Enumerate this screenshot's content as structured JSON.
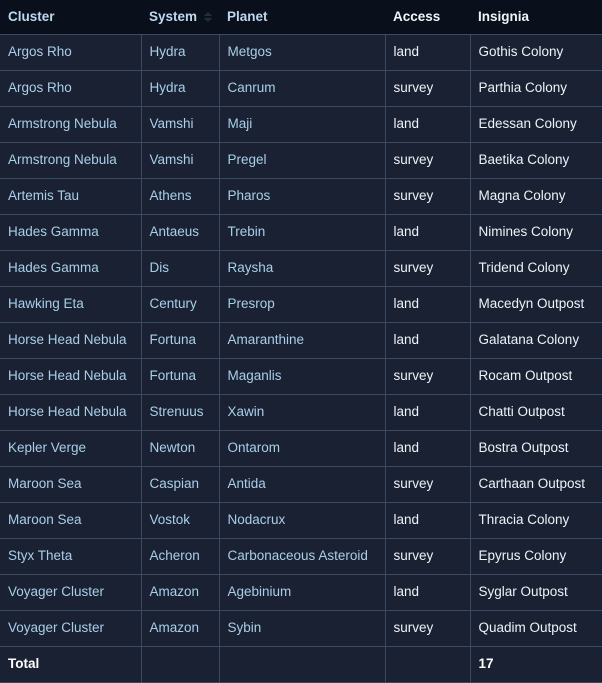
{
  "table": {
    "columns": [
      {
        "key": "cluster",
        "label": "Cluster",
        "style": "link",
        "sortable": true,
        "sort_indicator": false
      },
      {
        "key": "system",
        "label": "System",
        "style": "link",
        "sortable": true,
        "sort_indicator": true
      },
      {
        "key": "planet",
        "label": "Planet",
        "style": "link",
        "sortable": true,
        "sort_indicator": false
      },
      {
        "key": "access",
        "label": "Access",
        "style": "plain",
        "sortable": false,
        "sort_indicator": false
      },
      {
        "key": "insignia",
        "label": "Insignia",
        "style": "plain",
        "sortable": false,
        "sort_indicator": false
      }
    ],
    "rows": [
      {
        "cluster": "Argos Rho",
        "system": "Hydra",
        "planet": "Metgos",
        "access": "land",
        "insignia": "Gothis Colony"
      },
      {
        "cluster": "Argos Rho",
        "system": "Hydra",
        "planet": "Canrum",
        "access": "survey",
        "insignia": "Parthia Colony"
      },
      {
        "cluster": "Armstrong Nebula",
        "system": "Vamshi",
        "planet": "Maji",
        "access": "land",
        "insignia": "Edessan Colony"
      },
      {
        "cluster": "Armstrong Nebula",
        "system": "Vamshi",
        "planet": "Pregel",
        "access": "survey",
        "insignia": "Baetika Colony"
      },
      {
        "cluster": "Artemis Tau",
        "system": "Athens",
        "planet": "Pharos",
        "access": "survey",
        "insignia": "Magna Colony"
      },
      {
        "cluster": "Hades Gamma",
        "system": "Antaeus",
        "planet": "Trebin",
        "access": "land",
        "insignia": "Nimines Colony"
      },
      {
        "cluster": "Hades Gamma",
        "system": "Dis",
        "planet": "Raysha",
        "access": "survey",
        "insignia": "Tridend Colony"
      },
      {
        "cluster": "Hawking Eta",
        "system": "Century",
        "planet": "Presrop",
        "access": "land",
        "insignia": "Macedyn Outpost"
      },
      {
        "cluster": "Horse Head Nebula",
        "system": "Fortuna",
        "planet": "Amaranthine",
        "access": "land",
        "insignia": "Galatana Colony"
      },
      {
        "cluster": "Horse Head Nebula",
        "system": "Fortuna",
        "planet": "Maganlis",
        "access": "survey",
        "insignia": "Rocam Outpost"
      },
      {
        "cluster": "Horse Head Nebula",
        "system": "Strenuus",
        "planet": "Xawin",
        "access": "land",
        "insignia": "Chatti Outpost"
      },
      {
        "cluster": "Kepler Verge",
        "system": "Newton",
        "planet": "Ontarom",
        "access": "land",
        "insignia": "Bostra Outpost"
      },
      {
        "cluster": "Maroon Sea",
        "system": "Caspian",
        "planet": "Antida",
        "access": "survey",
        "insignia": "Carthaan Outpost"
      },
      {
        "cluster": "Maroon Sea",
        "system": "Vostok",
        "planet": "Nodacrux",
        "access": "land",
        "insignia": "Thracia Colony"
      },
      {
        "cluster": "Styx Theta",
        "system": "Acheron",
        "planet": "Carbonaceous Asteroid",
        "access": "survey",
        "insignia": "Epyrus Colony"
      },
      {
        "cluster": "Voyager Cluster",
        "system": "Amazon",
        "planet": "Agebinium",
        "access": "land",
        "insignia": "Syglar Outpost"
      },
      {
        "cluster": "Voyager Cluster",
        "system": "Amazon",
        "planet": "Sybin",
        "access": "survey",
        "insignia": "Quadim Outpost"
      }
    ],
    "total_row": {
      "label": "Total",
      "system": "",
      "planet": "",
      "access": "",
      "count": "17"
    }
  },
  "colors": {
    "header_background": "#0a0f1c",
    "row_background": "#1a2133",
    "border": "#3b4a63",
    "link_text": "#a9cfe8",
    "header_link_text": "#bcd9ef",
    "plain_text": "#eef3f8"
  }
}
